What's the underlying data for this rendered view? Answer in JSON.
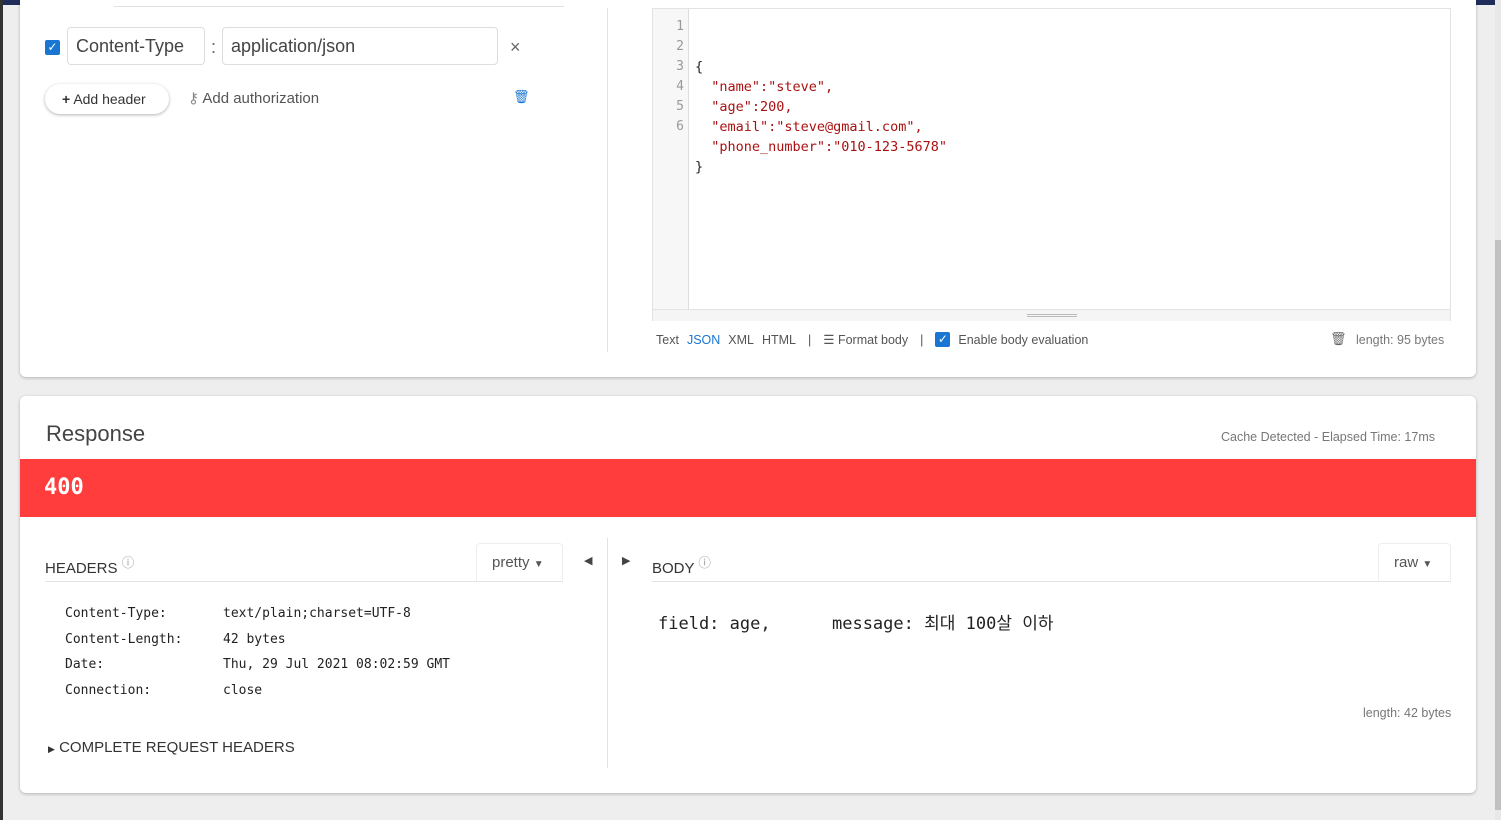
{
  "request": {
    "header_row": {
      "enabled": true,
      "name": "Content-Type",
      "separator": ":",
      "value": "application/json"
    },
    "add_header": "Add header",
    "add_authorization": "Add authorization",
    "body_lines": [
      "{",
      "  \"name\":\"steve\",",
      "  \"age\":200,",
      "  \"email\":\"steve@gmail.com\",",
      "  \"phone_number\":\"010-123-5678\"",
      "}"
    ],
    "line_numbers": [
      "1",
      "2",
      "3",
      "4",
      "5",
      "6"
    ],
    "formats": [
      "Text",
      "JSON",
      "XML",
      "HTML"
    ],
    "active_format": "JSON",
    "format_body": "Format body",
    "sep": "|",
    "enable_eval": "Enable body evaluation",
    "eval_enabled": true,
    "length": "length: 95 bytes"
  },
  "response": {
    "title": "Response",
    "cache": "Cache Detected - Elapsed Time: 17ms",
    "status": "400",
    "status_color": "#ff3d3d",
    "headers_label": "HEADERS",
    "pretty": "pretty",
    "body_label": "BODY",
    "raw": "raw",
    "headers": [
      [
        "Content-Type:",
        "text/plain;charset=UTF-8"
      ],
      [
        "Content-Length:",
        "42 bytes"
      ],
      [
        "Date:",
        "Thu, 29 Jul 2021 08:02:59 GMT"
      ],
      [
        "Connection:",
        "close"
      ]
    ],
    "complete": "COMPLETE REQUEST HEADERS",
    "body": "field: age,      message: 최대 100살 이하",
    "length": "length: 42 bytes"
  }
}
